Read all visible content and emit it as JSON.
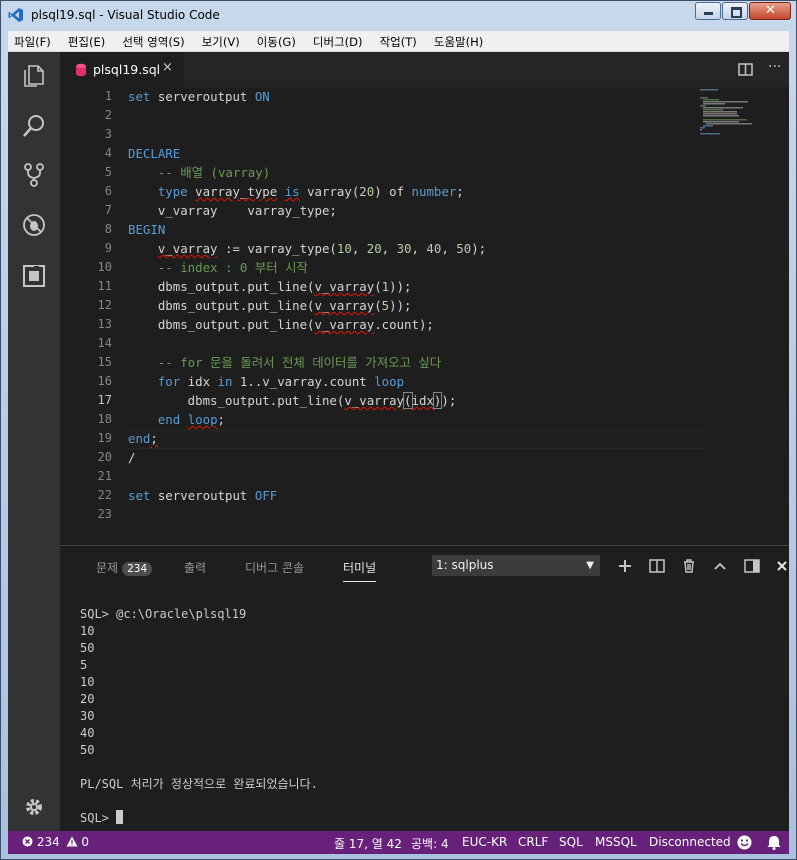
{
  "window": {
    "title": "plsql19.sql - Visual Studio Code"
  },
  "menu": [
    "파일(F)",
    "편집(E)",
    "선택 영역(S)",
    "보기(V)",
    "이동(G)",
    "디버그(D)",
    "작업(T)",
    "도움말(H)"
  ],
  "tab": {
    "filename": "plsql19.sql",
    "close": "×"
  },
  "editor": {
    "line_numbers": [
      "1",
      "2",
      "3",
      "4",
      "5",
      "6",
      "7",
      "8",
      "9",
      "10",
      "11",
      "12",
      "13",
      "14",
      "15",
      "16",
      "17",
      "18",
      "19",
      "20",
      "21",
      "22",
      "23"
    ],
    "current_line": 17
  },
  "panel": {
    "tabs": {
      "problems": "문제",
      "problems_count": "234",
      "output": "출력",
      "debug_console": "디버그 콘솔",
      "terminal": "터미널"
    },
    "terminal_select": "1: sqlplus",
    "terminal_lines": [
      "SQL> @c:\\Oracle\\plsql19",
      "10",
      "50",
      "5",
      "10",
      "20",
      "30",
      "40",
      "50",
      "",
      "PL/SQL 처리가 정상적으로 완료되었습니다.",
      ""
    ],
    "prompt": "SQL> "
  },
  "status": {
    "errors": "234",
    "warnings": "0",
    "position": "줄 17, 열 42",
    "spaces": "공백: 4",
    "encoding": "EUC-KR",
    "eol": "CRLF",
    "language": "SQL",
    "connection_type": "MSSQL",
    "connection": "Disconnected"
  },
  "colors": {
    "accent": "#68217a",
    "keyword": "#569cd6",
    "comment": "#6a9955",
    "number": "#b5cea8"
  }
}
